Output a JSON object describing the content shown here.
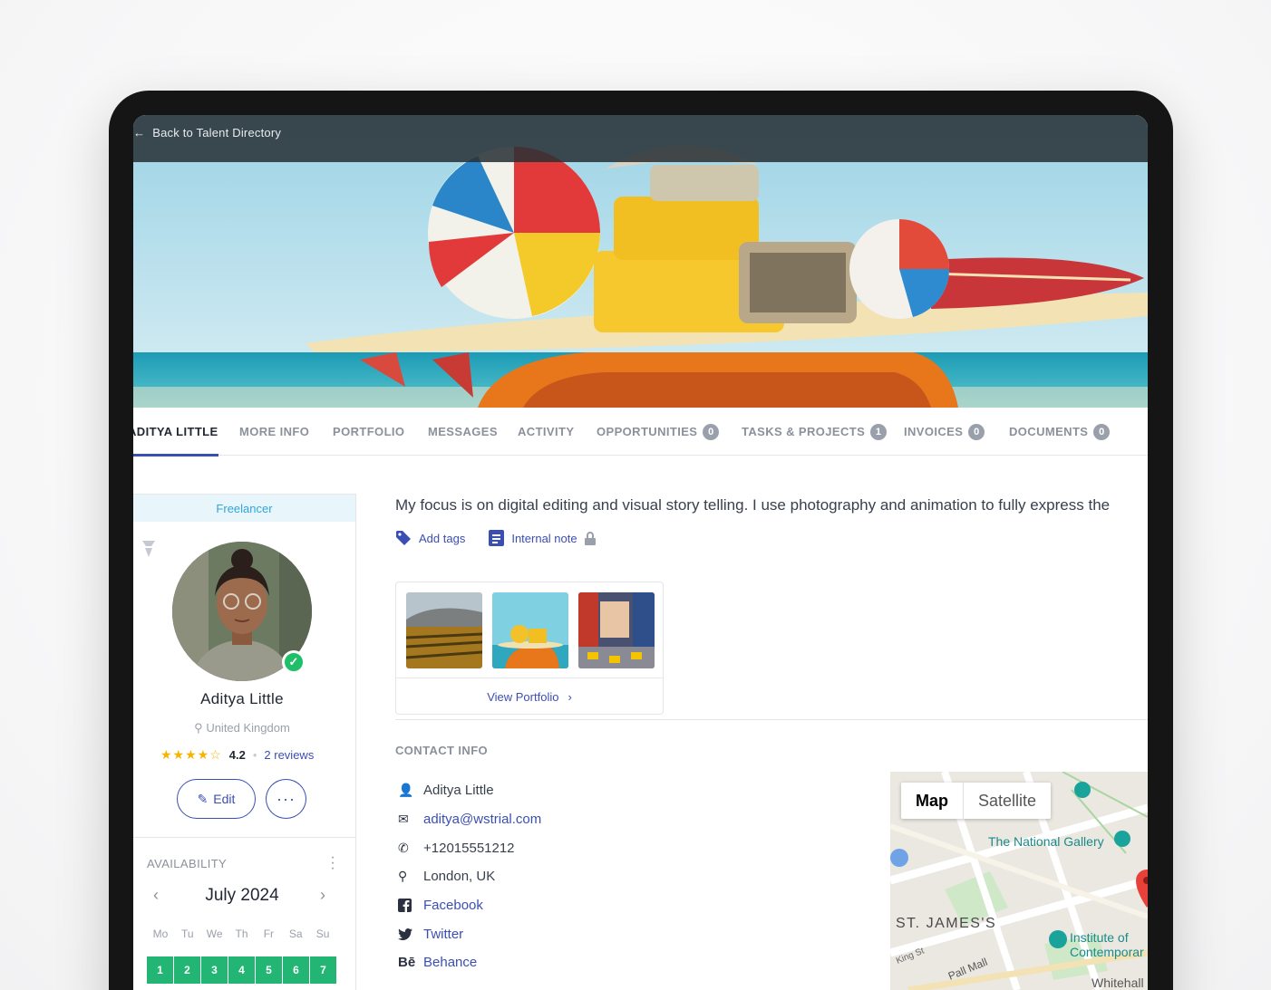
{
  "nav": {
    "back_label": "Back to Talent Directory"
  },
  "tabs": [
    {
      "label": "ADITYA LITTLE",
      "active": true
    },
    {
      "label": "MORE INFO"
    },
    {
      "label": "PORTFOLIO"
    },
    {
      "label": "MESSAGES"
    },
    {
      "label": "ACTIVITY"
    },
    {
      "label": "OPPORTUNITIES",
      "count": "0"
    },
    {
      "label": "TASKS & PROJECTS",
      "count": "1"
    },
    {
      "label": "INVOICES",
      "count": "0"
    },
    {
      "label": "DOCUMENTS",
      "count": "0"
    }
  ],
  "profile": {
    "type": "Freelancer",
    "name": "Aditya Little",
    "location": "United Kingdom",
    "rating": "4.2",
    "stars": "★★★★☆",
    "reviews": "2 reviews",
    "edit_label": "Edit",
    "more_label": "···"
  },
  "availability": {
    "title": "AVAILABILITY",
    "month": "July 2024",
    "weekdays": [
      "Mo",
      "Tu",
      "We",
      "Th",
      "Fr",
      "Sa",
      "Su"
    ],
    "days": [
      "1",
      "2",
      "3",
      "4",
      "5",
      "6",
      "7"
    ]
  },
  "main": {
    "bio": "My focus is on digital editing and visual story telling. I use photography and animation to fully express the",
    "add_tags": "Add tags",
    "internal_note": "Internal note",
    "view_portfolio": "View Portfolio"
  },
  "contact": {
    "title": "CONTACT INFO",
    "items": [
      {
        "icon": "person-icon",
        "text": "Aditya Little"
      },
      {
        "icon": "mail-icon",
        "text": "aditya@wstrial.com"
      },
      {
        "icon": "phone-icon",
        "text": "+12015551212"
      },
      {
        "icon": "location-pin-icon",
        "text": "London, UK"
      },
      {
        "icon": "facebook-icon",
        "text": "Facebook"
      },
      {
        "icon": "twitter-icon",
        "text": "Twitter"
      },
      {
        "icon": "behance-icon",
        "text": "Behance"
      }
    ]
  },
  "map": {
    "toggle_map": "Map",
    "toggle_satellite": "Satellite",
    "labels": [
      "The National Gallery",
      "ST. JAMES'S",
      "Institute of",
      "Contemporar",
      "Pall Mall",
      "King St",
      "Whitehall"
    ]
  },
  "colors": {
    "accent": "#3b4fb2",
    "available": "#22b573",
    "verified": "#1fbf6a",
    "freelancer": "#2fa6d8"
  }
}
